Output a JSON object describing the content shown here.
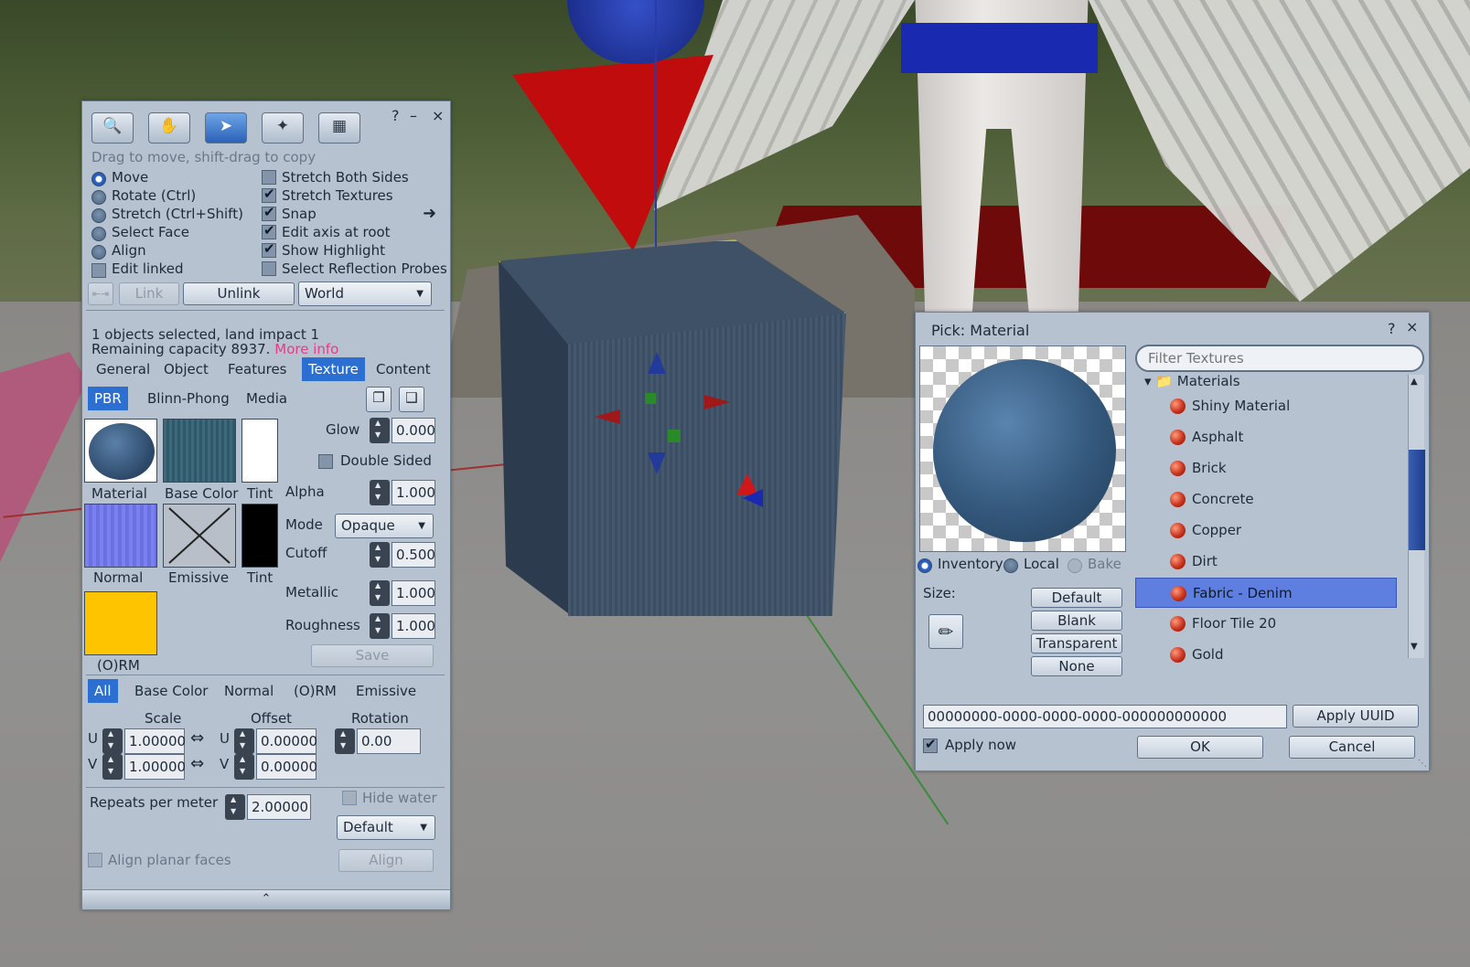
{
  "build_tools": {
    "help": "?",
    "minimize": "–",
    "close": "×",
    "hint": "Drag to move, shift-drag to copy",
    "tools": [
      {
        "name": "focus-tool",
        "icon": "magnifier-icon"
      },
      {
        "name": "move-tool",
        "icon": "hand-icon"
      },
      {
        "name": "edit-tool",
        "icon": "pointer-icon"
      },
      {
        "name": "create-tool",
        "icon": "wand-icon"
      },
      {
        "name": "land-tool",
        "icon": "bulldozer-icon"
      }
    ],
    "modes": {
      "move": "Move",
      "rotate": "Rotate (Ctrl)",
      "stretch": "Stretch (Ctrl+Shift)",
      "select_face": "Select Face",
      "align": "Align",
      "edit_linked": "Edit linked"
    },
    "options": {
      "stretch_both": "Stretch Both Sides",
      "stretch_textures": "Stretch Textures",
      "snap": "Snap",
      "edit_axis": "Edit axis at root",
      "show_highlight": "Show Highlight",
      "select_probes": "Select Reflection Probes"
    },
    "link": "Link",
    "unlink": "Unlink",
    "ruler": "World",
    "selection_info": "1 objects selected, land impact 1",
    "capacity": "Remaining capacity 8937.",
    "more_info": "More info",
    "tabs": [
      "General",
      "Object",
      "Features",
      "Texture",
      "Content"
    ],
    "subtabs": [
      "PBR",
      "Blinn-Phong",
      "Media"
    ],
    "swatch_labels": {
      "material": "Material",
      "base_color": "Base Color",
      "tint": "Tint",
      "normal": "Normal",
      "emissive": "Emissive",
      "tint2": "Tint",
      "orm": "(O)RM"
    },
    "fields": {
      "glow_label": "Glow",
      "glow": "0.000",
      "double_sided": "Double Sided",
      "alpha_label": "Alpha",
      "alpha": "1.000",
      "mode_label": "Mode",
      "mode": "Opaque",
      "cutoff_label": "Cutoff",
      "cutoff": "0.500",
      "metallic_label": "Metallic",
      "metallic": "1.000",
      "roughness_label": "Roughness",
      "roughness": "1.000"
    },
    "save": "Save",
    "map_tabs": [
      "All",
      "Base Color",
      "Normal",
      "(O)RM",
      "Emissive"
    ],
    "transform": {
      "scale": "Scale",
      "offset": "Offset",
      "rotation": "Rotation",
      "u": "U",
      "v": "V",
      "scale_u": "1.00000",
      "scale_v": "1.00000",
      "offset_u": "0.00000",
      "offset_v": "0.00000",
      "rotation_value": "0.00"
    },
    "repeats_label": "Repeats per meter",
    "repeats": "2.00000",
    "hide_water": "Hide water",
    "mapping": "Default",
    "align_planar": "Align planar faces",
    "align": "Align"
  },
  "picker": {
    "title": "Pick: Material",
    "help": "?",
    "close": "×",
    "filter_placeholder": "Filter Textures",
    "folder": "Materials",
    "items": [
      "Shiny Material",
      "Asphalt",
      "Brick",
      "Concrete",
      "Copper",
      "Dirt",
      "Fabric - Denim",
      "Floor Tile 20",
      "Gold"
    ],
    "selected_item": "Fabric - Denim",
    "sources": {
      "inventory": "Inventory",
      "local": "Local",
      "bake": "Bake"
    },
    "size_label": "Size:",
    "buttons": {
      "default": "Default",
      "blank": "Blank",
      "transparent": "Transparent",
      "none": "None"
    },
    "uuid": "00000000-0000-0000-0000-000000000000",
    "apply_uuid": "Apply UUID",
    "apply_now": "Apply now",
    "ok": "OK",
    "cancel": "Cancel"
  },
  "colors": {
    "panel": "#b6c2d0",
    "accent": "#2a6fd1",
    "orm_swatch": "#ffc400",
    "link_pink": "#e0408a"
  }
}
